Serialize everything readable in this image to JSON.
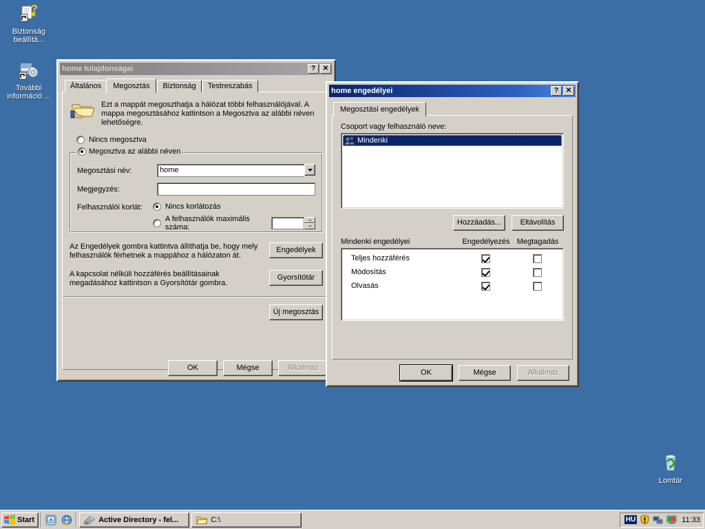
{
  "desktop": {
    "background_color": "#3a6ea5",
    "icons": [
      {
        "name": "security-settings",
        "label": "Biztonság beállítá...",
        "icon": "security-config-shortcut-icon"
      },
      {
        "name": "more-information",
        "label": "További információ ...",
        "icon": "media-cd-shortcut-icon"
      },
      {
        "name": "recycle-bin",
        "label": "Lomtár",
        "icon": "recycle-bin-icon"
      }
    ]
  },
  "properties_dialog": {
    "title": "home tulajdonságai",
    "help_button": "?",
    "close_button": "✕",
    "tabs": [
      {
        "label": "Általános",
        "active": false
      },
      {
        "label": "Megosztás",
        "active": true
      },
      {
        "label": "Biztonság",
        "active": false
      },
      {
        "label": "Testreszabás",
        "active": false
      }
    ],
    "description": "Ezt a mappát megoszthatja a hálózat többi felhasználójával.  A mappa megosztásához kattintson a Megosztva az alábbi néven lehetőségre.",
    "share_icon": "shared-folder-icon",
    "radio_not_shared": "Nincs megosztva",
    "radio_shared": "Megosztva az alábbi néven",
    "radio_selected": "shared",
    "share_name_label": "Megosztási név:",
    "share_name_value": "home",
    "comment_label": "Megjegyzés:",
    "comment_value": "",
    "user_limit_label": "Felhasználói korlát:",
    "user_limit_unlimited": "Nincs korlátozás",
    "user_limit_max": "A felhasználók maximális száma:",
    "user_limit_max_value": "",
    "permissions_hint": "Az Engedélyek gombra kattintva állíthatja be, hogy mely felhasználók férhetnek a mappához a hálózaton át.",
    "permissions_button": "Engedélyek",
    "cache_hint": "A kapcsolat nélküli hozzáférés beállításainak megadásához kattintson a Gyorsítótár gombra.",
    "cache_button": "Gyorsítótár",
    "new_share_button": "Új megosztás",
    "ok_button": "OK",
    "cancel_button": "Mégse",
    "apply_button": "Alkalmaz"
  },
  "permissions_dialog": {
    "title": "home engedélyei",
    "help_button": "?",
    "close_button": "✕",
    "tabs": [
      {
        "label": "Megosztási engedélyek",
        "active": true
      }
    ],
    "group_list_label": "Csoport vagy felhasználó neve:",
    "group_list_items": [
      {
        "label": "Mindenki",
        "icon": "users-group-icon",
        "selected": true
      }
    ],
    "add_button": "Hozzáadás...",
    "remove_button": "Eltávolítás",
    "perm_table_title": "Mindenki engedélyei",
    "perm_col_allow": "Engedélyezés",
    "perm_col_deny": "Megtagadás",
    "permissions": [
      {
        "label": "Teljes hozzáférés",
        "allow": true,
        "deny": false
      },
      {
        "label": "Módosítás",
        "allow": true,
        "deny": false
      },
      {
        "label": "Olvasás",
        "allow": true,
        "deny": false
      }
    ],
    "ok_button": "OK",
    "cancel_button": "Mégse",
    "apply_button": "Alkalmaz"
  },
  "taskbar": {
    "start_label": "Start",
    "quick_launch": [
      {
        "name": "show-desktop",
        "icon": "show-desktop-icon"
      },
      {
        "name": "internet-explorer",
        "icon": "internet-explorer-icon"
      }
    ],
    "tasks": [
      {
        "label": "Active Directory - fel...",
        "icon": "active-directory-icon",
        "active": true
      },
      {
        "label": "C:\\",
        "icon": "folder-icon",
        "active": false
      }
    ],
    "tray": {
      "language": "HU",
      "icons": [
        {
          "name": "security-shield-icon"
        },
        {
          "name": "network-connection-icon"
        },
        {
          "name": "display-settings-icon"
        }
      ],
      "clock": "11:33"
    }
  }
}
